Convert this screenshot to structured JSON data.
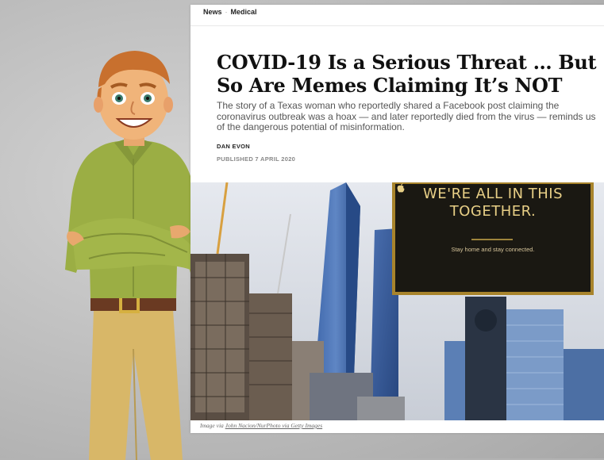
{
  "breadcrumb": {
    "items": [
      "News",
      "Medical"
    ],
    "separator": "·"
  },
  "article": {
    "title": "COVID-19 Is a Serious Threat … But So Are Memes Claiming It’s NOT",
    "dek": "The story of a Texas woman who reportedly shared a Facebook post claiming the coronavirus outbreak was a hoax — and later reportedly died from the virus — reminds us of the dangerous potential of misinformation.",
    "author": "DAN EVON",
    "published": "PUBLISHED 7 APRIL 2020"
  },
  "photo": {
    "sign_title": "WE'RE ALL IN THIS\nTOGETHER.",
    "sign_subtitle": "Stay home and stay connected.",
    "sign_icon": "apple-logo"
  },
  "caption": {
    "prefix": "Image via ",
    "credit": "John Nacion/NurPhoto via Getty Images"
  },
  "colors": {
    "sign_background": "#1a1812",
    "sign_border": "#a8842c",
    "sign_text": "#e8cf86",
    "sky": "#d8dde6"
  }
}
